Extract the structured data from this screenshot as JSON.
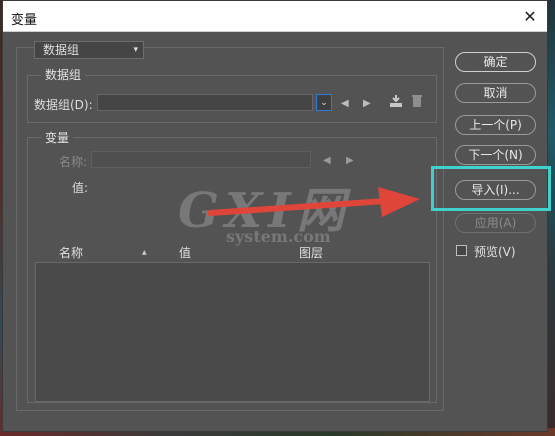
{
  "dialog": {
    "title": "变量",
    "close_glyph": "✕"
  },
  "dataset_select": {
    "value": "数据组",
    "chevron": "▾"
  },
  "dataset_group": {
    "legend": "数据组",
    "field_label": "数据组(D):",
    "field_value": "",
    "dropdown_glyph": "⌄",
    "prev_glyph": "◀",
    "next_glyph": "▶",
    "import_icon": "import-dataset-icon",
    "delete_icon": "trash-icon"
  },
  "variable_group": {
    "legend": "变量",
    "name_label": "名称:",
    "name_value": "",
    "prev_glyph": "◀",
    "next_glyph": "▶",
    "value_label": "值:"
  },
  "table": {
    "columns": [
      "名称",
      "值",
      "图层"
    ],
    "sort_indicator": "▲",
    "rows": []
  },
  "buttons": {
    "ok": "确定",
    "cancel": "取消",
    "prev": "上一个(P)",
    "next": "下一个(N)",
    "import": "导入(I)...",
    "apply": "应用(A)"
  },
  "preview": {
    "label": "预览(V)",
    "checked": false
  },
  "watermark": {
    "logo": "GXI网",
    "sub": "system.com"
  },
  "colors": {
    "dialog_bg": "#535353",
    "highlight": "#3fd1cc",
    "annotation_arrow": "#e0453a",
    "focus_blue": "#2f7bd6"
  }
}
